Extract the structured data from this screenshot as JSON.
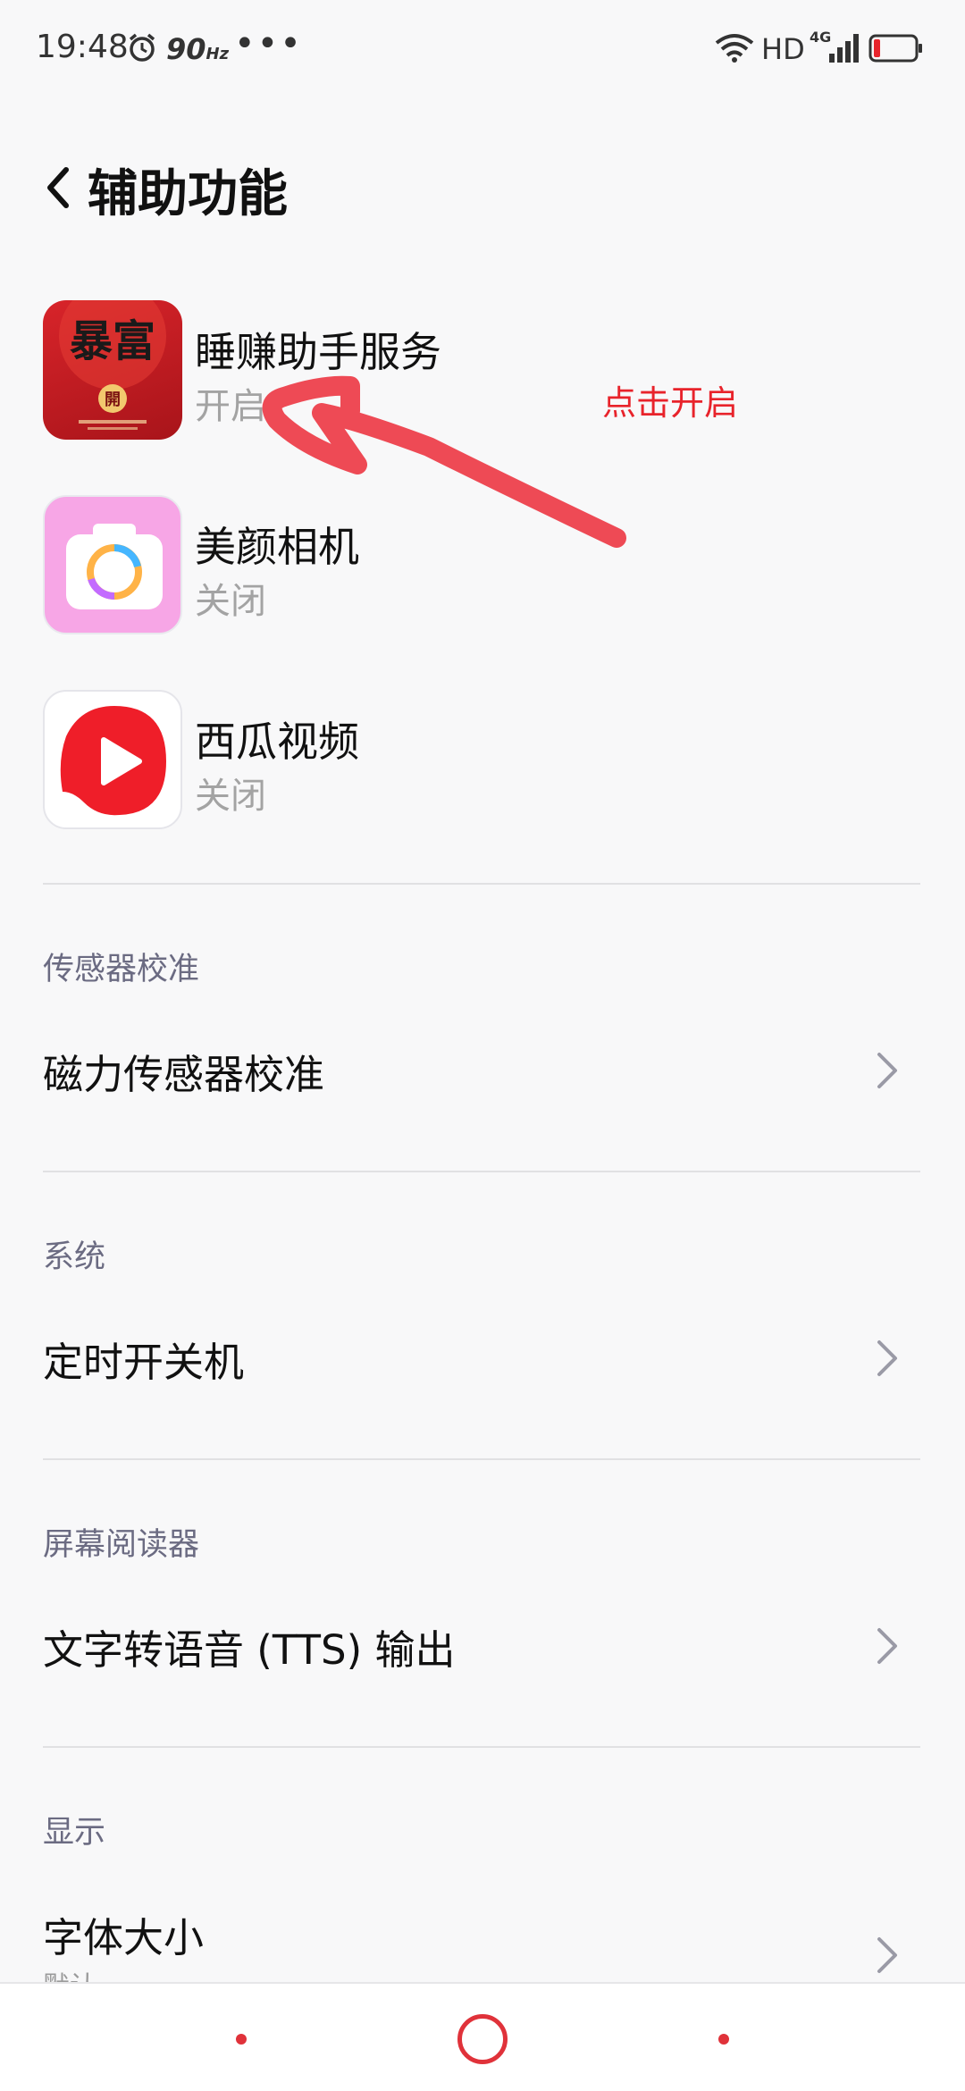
{
  "status_bar": {
    "time": "19:48",
    "refresh_rate": "90",
    "refresh_unit": "Hz",
    "more": "•••",
    "hd": "HD",
    "network": "4G",
    "battery_level": 0.12
  },
  "header": {
    "title": "辅助功能"
  },
  "apps": [
    {
      "name": "睡赚助手服务",
      "status": "开启"
    },
    {
      "name": "美颜相机",
      "status": "关闭"
    },
    {
      "name": "西瓜视频",
      "status": "关闭"
    }
  ],
  "annotation": {
    "text": "点击开启",
    "color": "#e8232b"
  },
  "sections": {
    "sensor": {
      "label": "传感器校准",
      "item": "磁力传感器校准"
    },
    "system": {
      "label": "系统",
      "item": "定时开关机"
    },
    "reader": {
      "label": "屏幕阅读器",
      "item": "文字转语音 (TTS) 输出"
    },
    "display": {
      "label": "显示",
      "item": "字体大小",
      "sub": "默认"
    }
  },
  "icon_art": {
    "app1_text": "暴富",
    "app1_badge": "開"
  },
  "colors": {
    "accent": "#e0323a",
    "section_text": "#6b6b82"
  }
}
